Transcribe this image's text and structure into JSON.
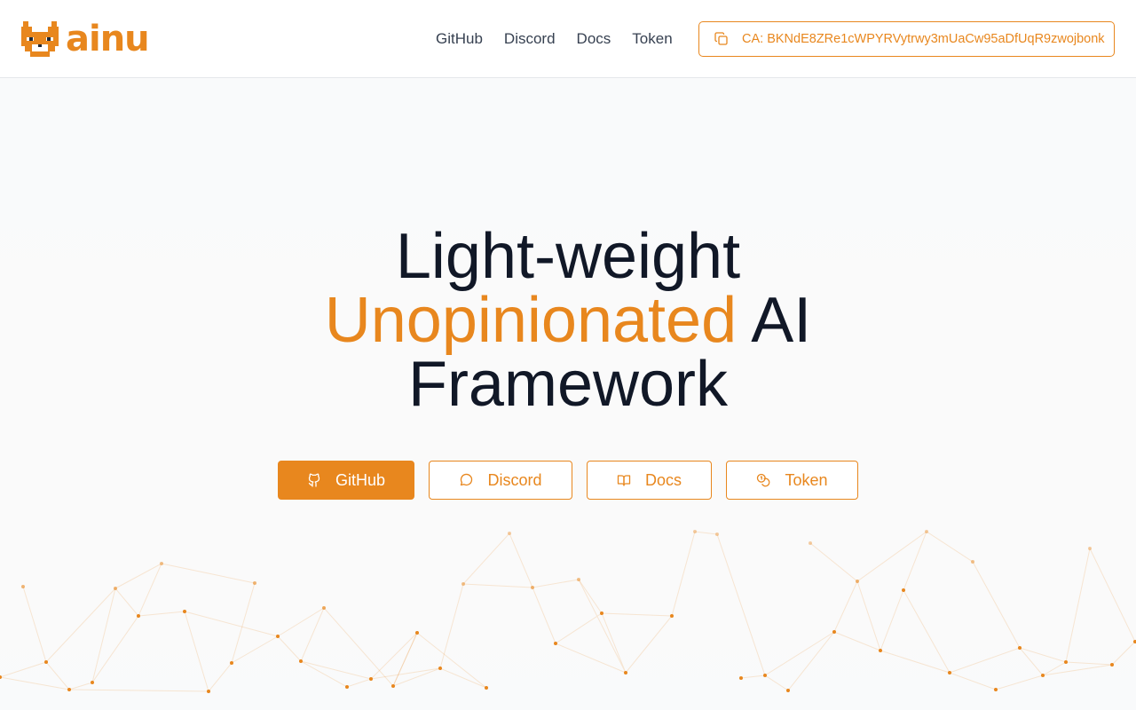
{
  "header": {
    "logo_text": "ainu",
    "nav": [
      "GitHub",
      "Discord",
      "Docs",
      "Token"
    ],
    "ca_label": "CA: BKNdE8ZRe1cWPYRVytrwy3mUaCw95aDfUqR9zwojbonk"
  },
  "hero": {
    "line1": "Light-weight",
    "line2_accent": "Unopinionated",
    "line2_rest": "AI",
    "line3": "Framework"
  },
  "buttons": [
    {
      "label": "GitHub",
      "icon": "github-icon"
    },
    {
      "label": "Discord",
      "icon": "chat-bubble-icon"
    },
    {
      "label": "Docs",
      "icon": "book-icon"
    },
    {
      "label": "Token",
      "icon": "coins-icon"
    }
  ],
  "colors": {
    "accent": "#e8871e",
    "text": "#111827",
    "nav_text": "#374151",
    "background": "#f9fafb"
  }
}
